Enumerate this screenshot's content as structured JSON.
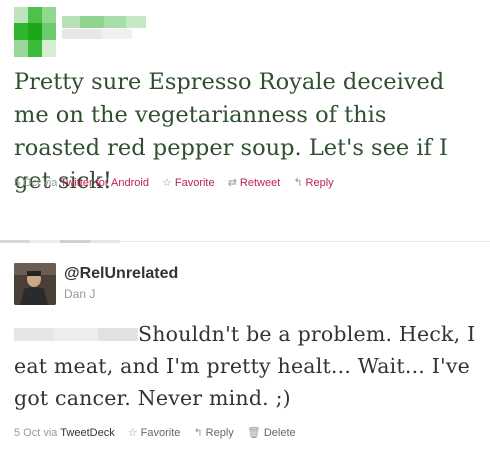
{
  "tweet1": {
    "text": "Pretty sure Espresso Royale deceived me on the vegetarianness of this roasted red pepper soup. Let's see if I get sick!",
    "timestamp": "5 Oct",
    "via_label": "via",
    "client": "Twitter for Android",
    "actions": {
      "favorite": "Favorite",
      "retweet": "Retweet",
      "reply": "Reply"
    }
  },
  "tweet2": {
    "handle": "@RelUnrelated",
    "name": "Dan J",
    "text": "Shouldn't be a problem. Heck, I eat meat, and I'm pretty healt... Wait... I've got cancer. Never mind. ;)",
    "timestamp": "5 Oct",
    "via_label": "via",
    "client": "TweetDeck",
    "actions": {
      "favorite": "Favorite",
      "reply": "Reply",
      "delete": "Delete"
    }
  },
  "icons": {
    "favorite": "star-icon",
    "retweet": "retweet-icon",
    "reply": "reply-icon",
    "delete": "trash-icon"
  },
  "colors": {
    "link": "#b8215f",
    "meta": "#999999",
    "text": "#333333"
  }
}
